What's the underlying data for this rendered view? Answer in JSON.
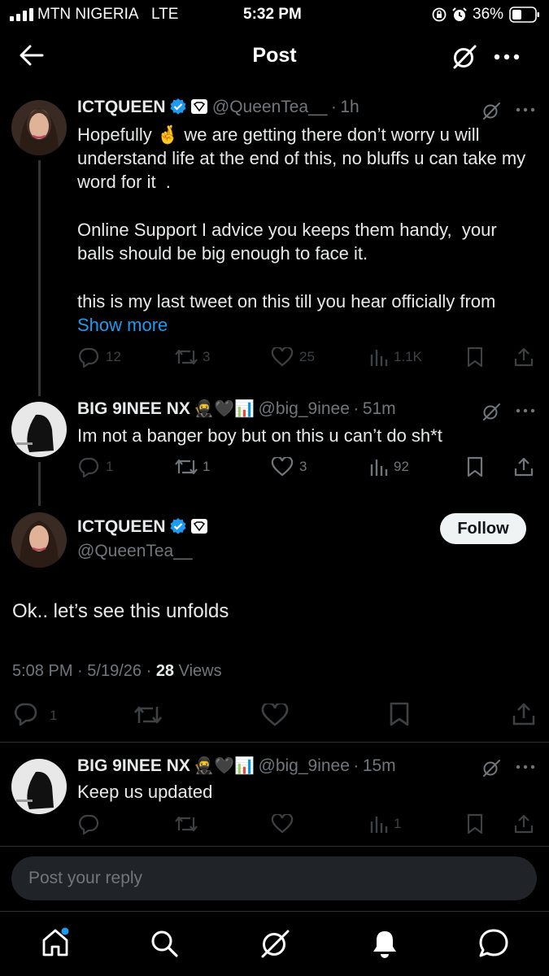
{
  "status_bar": {
    "carrier": "MTN NIGERIA",
    "network": "LTE",
    "time": "5:32 PM",
    "battery": "36%"
  },
  "header": {
    "title": "Post",
    "back_icon": "arrow-left-icon",
    "grok_icon": "grok-icon",
    "more_icon": "more-horizontal-icon"
  },
  "thread": [
    {
      "name": "ICTQUEEN",
      "handle": "@QueenTea__",
      "dot": "·",
      "time": "1h",
      "text_parts": {
        "p1a": "Hopefully ",
        "emoji": "🤞",
        "p1b": " we are getting there don’t worry u will understand life at the end of this, no bluffs u can take my word for it  .",
        "p2": "Online Support I advice you keeps them handy,  your balls should be big enough to face it.",
        "p3": "this is my last tweet on this till you hear officially from ",
        "show_more": "Show more"
      },
      "replies": "12",
      "reposts": "3",
      "likes": "25",
      "views": "1.1K"
    },
    {
      "name": "BIG 9INEE NX",
      "emojis": "🥷🖤📊",
      "handle": "@big_9inee",
      "dot": "·",
      "time": "51m",
      "text": "Im not a banger boy but on this u can’t do sh*t",
      "replies": "1",
      "reposts": "1",
      "likes": "3",
      "views": "92"
    }
  ],
  "main_post": {
    "name": "ICTQUEEN",
    "handle": "@QueenTea__",
    "follow_label": "Follow",
    "text": "Ok.. let’s see this unfolds",
    "time": "5:08 PM",
    "dot1": "·",
    "date": "5/19/26",
    "dot2": "·",
    "views_count": "28",
    "views_label": "Views",
    "replies": "1"
  },
  "reply": {
    "name": "BIG 9INEE NX",
    "emojis": "🥷🖤📊",
    "handle": "@big_9inee",
    "dot": "·",
    "time": "15m",
    "text": "Keep us updated",
    "views": "1"
  },
  "composer": {
    "placeholder": "Post your reply"
  },
  "tab_bar": [
    "home-icon",
    "search-icon",
    "grok-icon",
    "notifications-icon",
    "messages-icon"
  ],
  "colors": {
    "background": "#000000",
    "text": "#e7e9ea",
    "muted": "#71767b",
    "link": "#1d9bf0",
    "verified": "#1d9bf0"
  }
}
